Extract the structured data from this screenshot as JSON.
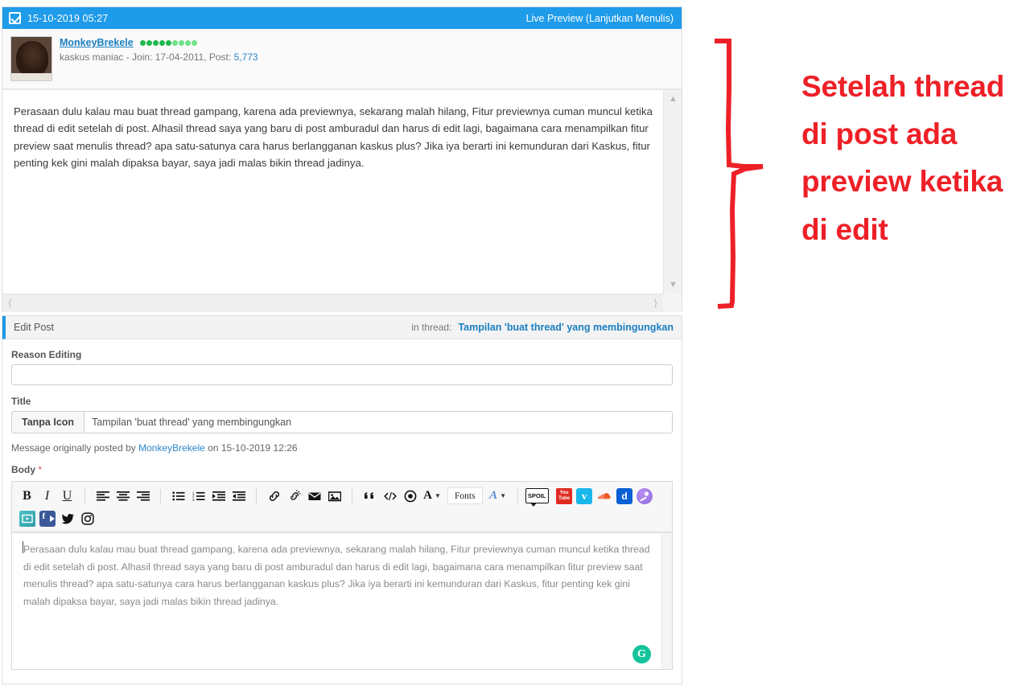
{
  "preview": {
    "bar": {
      "checkbox_icon": "checkbox-checked-icon",
      "date": "15-10-2019 05:27",
      "live_preview_label": "Live Preview (Lanjutkan Menulis)"
    },
    "poster": {
      "name": "MonkeyBrekele",
      "rep_filled": 5,
      "rep_total": 9,
      "rep_color_filled": "#1fb84c",
      "rep_color_empty": "#6ee38b",
      "meta_prefix": "kaskus maniac - Join: 17-04-2011, Post: ",
      "post_count": "5,773"
    },
    "body_text": "Perasaan dulu kalau mau buat thread gampang, karena ada previewnya, sekarang malah hilang, Fitur previewnya cuman muncul ketika thread di edit setelah di post. Alhasil thread saya yang baru di post amburadul dan harus di edit lagi, bagaimana cara menampilkan fitur preview saat menulis thread? apa satu-satunya cara harus berlangganan kaskus plus? Jika iya berarti ini kemunduran dari Kaskus, fitur penting kek gini malah dipaksa bayar, saya jadi malas bikin thread jadinya.",
    "scroll_up_icon": "chevron-up-icon",
    "scroll_down_icon": "chevron-down-icon",
    "scroll_left_icon": "chevron-left-icon",
    "scroll_right_icon": "chevron-right-icon"
  },
  "edit_post": {
    "heading": "Edit Post",
    "in_thread_label": "in thread:",
    "thread_link": "Tampilan 'buat thread' yang membingungkan",
    "reason_label": "Reason Editing",
    "reason_value": "",
    "reason_placeholder": "",
    "title_label": "Title",
    "icon_select_value": "Tanpa Icon",
    "title_value": "Tampilan 'buat thread' yang membingungkan",
    "original_note_prefix": "Message originally posted by ",
    "original_note_author": "MonkeyBrekele",
    "original_note_suffix": " on 15-10-2019 12:26",
    "body_label": "Body",
    "body_required_mark": "*",
    "body_value": "Perasaan dulu kalau mau buat thread gampang, karena ada previewnya, sekarang malah hilang, Fitur previewnya cuman muncul ketika thread di edit setelah di post. Alhasil thread saya yang baru di post amburadul dan harus di edit lagi, bagaimana cara menampilkan fitur preview saat menulis thread? apa satu-satunya cara harus berlangganan kaskus plus? Jika iya berarti ini kemunduran dari Kaskus, fitur penting kek gini malah dipaksa bayar, saya jadi malas bikin thread jadinya.",
    "grammarly_label": "G"
  },
  "toolbar": {
    "row1": [
      {
        "name": "bold-icon",
        "label": "B",
        "kind": "text-bold"
      },
      {
        "name": "italic-icon",
        "label": "I",
        "kind": "text-ital"
      },
      {
        "name": "underline-icon",
        "label": "U",
        "kind": "text-under"
      },
      {
        "name": "separator",
        "label": "",
        "kind": "sep"
      },
      {
        "name": "align-left-icon",
        "label": "",
        "kind": "align-left"
      },
      {
        "name": "align-center-icon",
        "label": "",
        "kind": "align-center"
      },
      {
        "name": "align-right-icon",
        "label": "",
        "kind": "align-right"
      },
      {
        "name": "separator",
        "label": "",
        "kind": "sep"
      },
      {
        "name": "bullet-list-icon",
        "label": "",
        "kind": "ul"
      },
      {
        "name": "numbered-list-icon",
        "label": "",
        "kind": "ol"
      },
      {
        "name": "indent-increase-icon",
        "label": "",
        "kind": "indent"
      },
      {
        "name": "indent-decrease-icon",
        "label": "",
        "kind": "outdent"
      },
      {
        "name": "separator",
        "label": "",
        "kind": "sep"
      },
      {
        "name": "insert-link-icon",
        "label": "",
        "kind": "link"
      },
      {
        "name": "remove-link-icon",
        "label": "",
        "kind": "unlink"
      },
      {
        "name": "email-icon",
        "label": "",
        "kind": "email"
      },
      {
        "name": "insert-image-icon",
        "label": "",
        "kind": "image"
      },
      {
        "name": "separator",
        "label": "",
        "kind": "sep"
      },
      {
        "name": "quote-icon",
        "label": "",
        "kind": "quote"
      },
      {
        "name": "code-icon",
        "label": "",
        "kind": "code"
      },
      {
        "name": "target-icon",
        "label": "",
        "kind": "target"
      },
      {
        "name": "text-color-icon",
        "label": "A",
        "kind": "textcolor"
      },
      {
        "name": "fonts-dropdown",
        "label": "Fonts",
        "kind": "fontschip"
      },
      {
        "name": "font-size-icon",
        "label": "A",
        "kind": "fontsize"
      },
      {
        "name": "separator",
        "label": "",
        "kind": "sep"
      },
      {
        "name": "spoiler-icon",
        "label": "SPOIL",
        "kind": "spoil"
      },
      {
        "name": "youtube-icon",
        "label": "",
        "kind": "youtube"
      },
      {
        "name": "vimeo-icon",
        "label": "v",
        "kind": "vimeo"
      },
      {
        "name": "soundcloud-icon",
        "label": "",
        "kind": "soundcloud"
      },
      {
        "name": "dailymotion-icon",
        "label": "d",
        "kind": "dailymotion"
      },
      {
        "name": "anchor-podcast-icon",
        "label": "",
        "kind": "anchor"
      }
    ],
    "row2": [
      {
        "name": "video-embed-icon",
        "label": "",
        "kind": "videoembed"
      },
      {
        "name": "facebook-video-icon",
        "label": "f",
        "kind": "fbvideo"
      },
      {
        "name": "twitter-icon",
        "label": "",
        "kind": "twitter"
      },
      {
        "name": "instagram-icon",
        "label": "",
        "kind": "instagram"
      }
    ]
  },
  "annotation": {
    "text": "Setelah thread di post ada preview ketika di edit",
    "color": "#ee2027",
    "brace_icon": "curly-brace-annotation"
  },
  "colors": {
    "accent_blue": "#1e9be9",
    "link_blue": "#1a7fc1",
    "annotation_red": "#ee2027",
    "grammarly_green": "#15c39a"
  }
}
